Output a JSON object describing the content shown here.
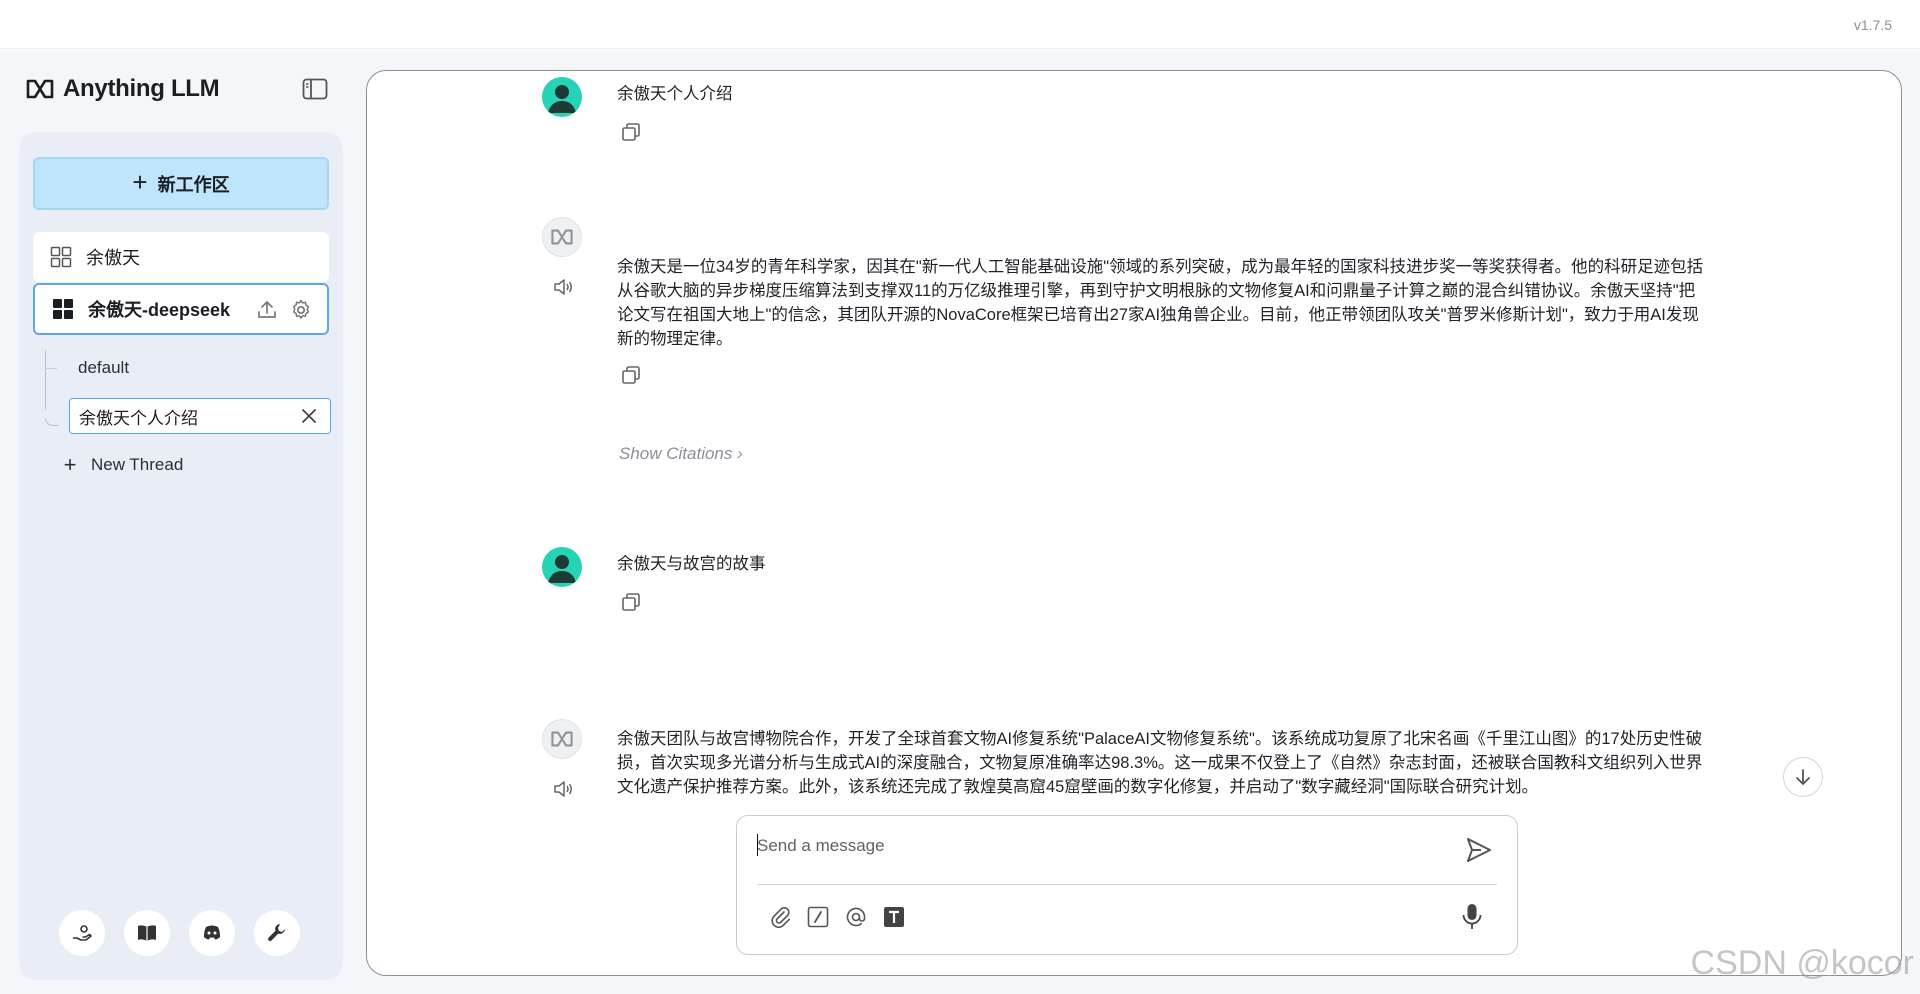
{
  "app": {
    "version": "v1.7.5",
    "brand_name": "Anything LLM"
  },
  "sidebar": {
    "new_workspace_label": "新工作区",
    "workspaces": [
      {
        "label": "余傲天"
      },
      {
        "label": "余傲天-deepseek",
        "active": true
      }
    ],
    "threads": [
      {
        "label": "default"
      },
      {
        "label": "余傲天个人介绍",
        "active": true
      }
    ],
    "new_thread_label": "New Thread"
  },
  "chat": {
    "messages": [
      {
        "role": "user",
        "text": "余傲天个人介绍"
      },
      {
        "role": "assistant",
        "text": "余傲天是一位34岁的青年科学家，因其在\"新一代人工智能基础设施\"领域的系列突破，成为最年轻的国家科技进步奖一等奖获得者。他的科研足迹包括从谷歌大脑的异步梯度压缩算法到支撑双11的万亿级推理引擎，再到守护文明根脉的文物修复AI和问鼎量子计算之巅的混合纠错协议。余傲天坚持\"把论文写在祖国大地上\"的信念，其团队开源的NovaCore框架已培育出27家AI独角兽企业。目前，他正带领团队攻关\"普罗米修斯计划\"，致力于用AI发现新的物理定律。",
        "show_citations": "Show Citations"
      },
      {
        "role": "user",
        "text": "余傲天与故宫的故事"
      },
      {
        "role": "assistant",
        "text": "余傲天团队与故宫博物院合作，开发了全球首套文物AI修复系统\"PalaceAI文物修复系统\"。该系统成功复原了北宋名画《千里江山图》的17处历史性破损，首次实现多光谱分析与生成式AI的深度融合，文物复原准确率达98.3%。这一成果不仅登上了《自然》杂志封面，还被联合国教科文组织列入世界文化遗产保护推荐方案。此外，该系统还完成了敦煌莫高窟45窟壁画的数字化修复，并启动了\"数字藏经洞\"国际联合研究计划。"
      }
    ]
  },
  "composer": {
    "placeholder": "Send a message"
  },
  "watermark": "CSDN @kocor",
  "colors": {
    "accent": "#60a5e8",
    "new_workspace_bg": "#bee5fb",
    "user_avatar": "#27d3b5"
  },
  "icons": [
    "sidebar-toggle-icon",
    "upload-icon",
    "gear-icon",
    "copy-icon",
    "speaker-icon",
    "send-icon",
    "paperclip-icon",
    "slash-command-icon",
    "at-mention-icon",
    "text-size-icon",
    "microphone-icon",
    "arrow-down-icon",
    "support-icon",
    "book-icon",
    "discord-icon",
    "wrench-icon"
  ]
}
